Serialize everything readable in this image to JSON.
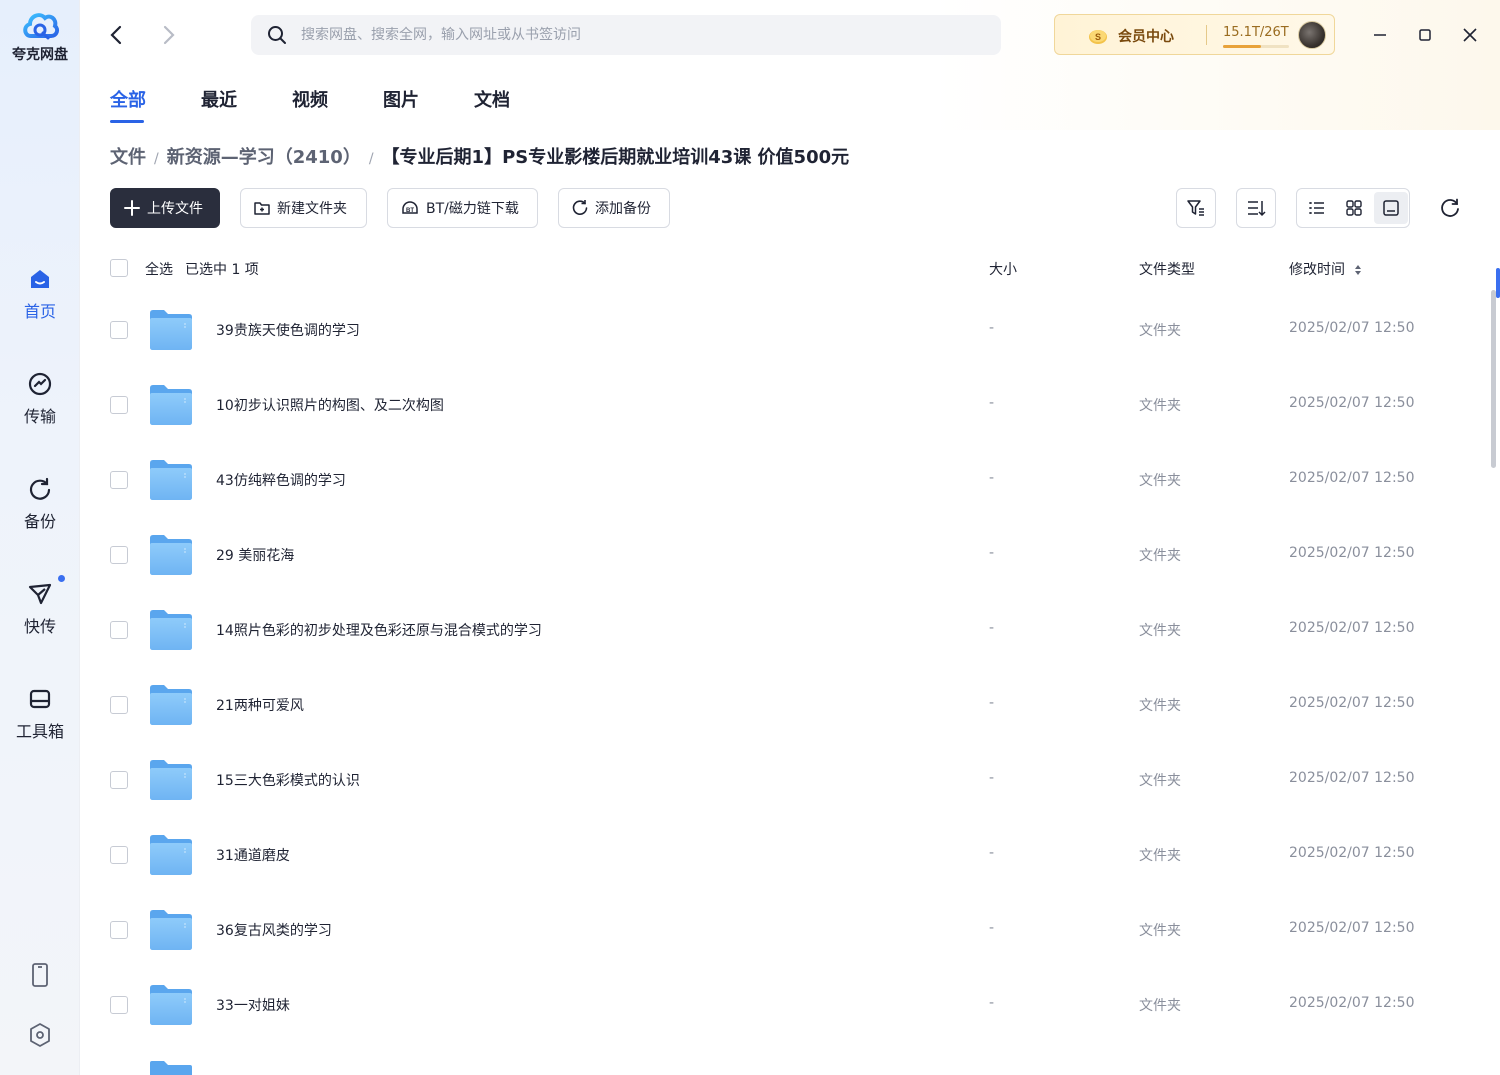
{
  "app": {
    "name": "夸克网盘",
    "brand_color": "#2a63e6"
  },
  "sidebar": {
    "items": [
      {
        "label": "首页",
        "icon": "home-icon",
        "active": true
      },
      {
        "label": "传输",
        "icon": "transfer-icon",
        "active": false
      },
      {
        "label": "备份",
        "icon": "backup-icon",
        "active": false
      },
      {
        "label": "快传",
        "icon": "quick-send-icon",
        "active": false,
        "has_dot": true
      },
      {
        "label": "工具箱",
        "icon": "toolbox-icon",
        "active": false
      }
    ],
    "bottom_icons": [
      "phone-icon",
      "settings-icon"
    ]
  },
  "topbar": {
    "search_placeholder": "搜索网盘、搜索全网，输入网址或从书签访问",
    "member_label": "会员中心",
    "storage_text": "15.1T/26T",
    "storage_used_fraction": 0.58
  },
  "tabs": [
    {
      "label": "全部",
      "active": true
    },
    {
      "label": "最近",
      "active": false
    },
    {
      "label": "视频",
      "active": false
    },
    {
      "label": "图片",
      "active": false
    },
    {
      "label": "文档",
      "active": false
    }
  ],
  "breadcrumb": {
    "items": [
      "文件",
      "新资源—学习（2410）"
    ],
    "current": "【专业后期1】PS专业影楼后期就业培训43课 价值500元"
  },
  "toolbar": {
    "upload_label": "上传文件",
    "new_folder_label": "新建文件夹",
    "bt_label": "BT/磁力链下载",
    "backup_label": "添加备份"
  },
  "table": {
    "select_all": "全选",
    "selected_text": "已选中  1  项",
    "col_size": "大小",
    "col_type": "文件类型",
    "col_time": "修改时间",
    "rows": [
      {
        "name": "39贵族天使色调的学习",
        "size": "-",
        "type": "文件夹",
        "time": "2025/02/07 12:50"
      },
      {
        "name": "10初步认识照片的构图、及二次构图",
        "size": "-",
        "type": "文件夹",
        "time": "2025/02/07 12:50"
      },
      {
        "name": "43仿纯粹色调的学习",
        "size": "-",
        "type": "文件夹",
        "time": "2025/02/07 12:50"
      },
      {
        "name": "29 美丽花海",
        "size": "-",
        "type": "文件夹",
        "time": "2025/02/07 12:50"
      },
      {
        "name": "14照片色彩的初步处理及色彩还原与混合模式的学习",
        "size": "-",
        "type": "文件夹",
        "time": "2025/02/07 12:50"
      },
      {
        "name": "21两种可爱风",
        "size": "-",
        "type": "文件夹",
        "time": "2025/02/07 12:50"
      },
      {
        "name": "15三大色彩模式的认识",
        "size": "-",
        "type": "文件夹",
        "time": "2025/02/07 12:50"
      },
      {
        "name": "31通道磨皮",
        "size": "-",
        "type": "文件夹",
        "time": "2025/02/07 12:50"
      },
      {
        "name": "36复古风类的学习",
        "size": "-",
        "type": "文件夹",
        "time": "2025/02/07 12:50"
      },
      {
        "name": "33一对姐妹",
        "size": "-",
        "type": "文件夹",
        "time": "2025/02/07 12:50"
      }
    ]
  }
}
